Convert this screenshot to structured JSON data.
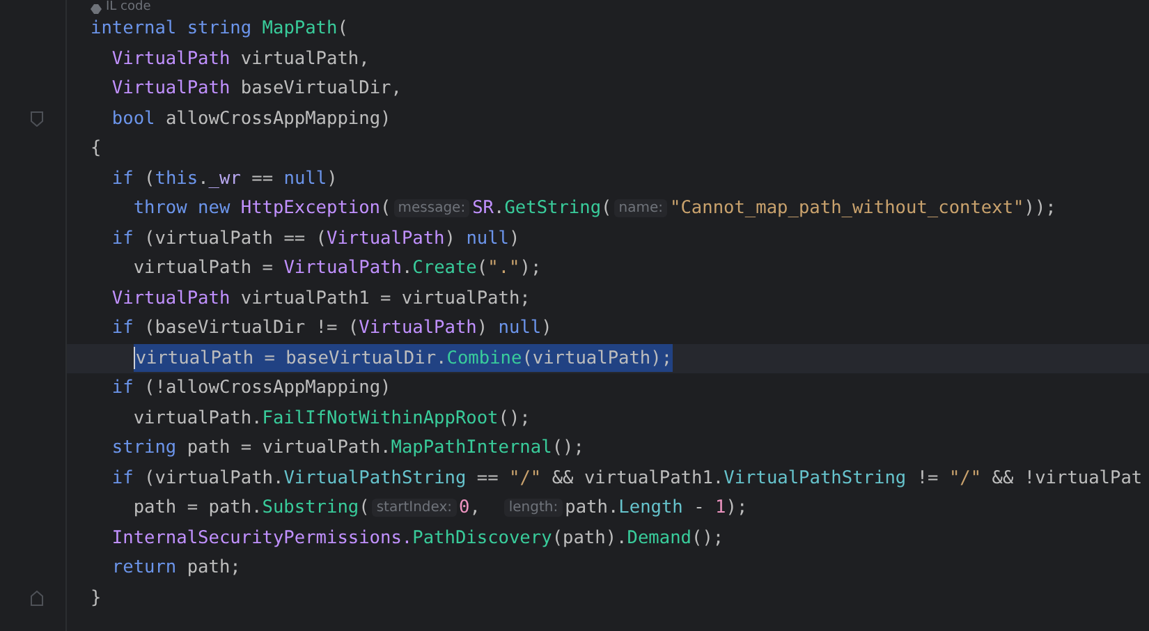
{
  "code_lens": {
    "label": "IL code"
  },
  "lines": [
    {
      "kind": "plain",
      "selected": false,
      "tokens": [
        {
          "kind": "kw",
          "text": "internal string "
        },
        {
          "kind": "method",
          "text": "MapPath"
        },
        {
          "kind": "plain",
          "text": "("
        }
      ],
      "children": [
        {
          "kind": "plain",
          "selected": false,
          "tokens": [
            {
              "kind": "type",
              "text": "VirtualPath"
            },
            {
              "kind": "plain",
              "text": " virtualPath,"
            }
          ]
        },
        {
          "kind": "plain",
          "selected": false,
          "tokens": [
            {
              "kind": "type",
              "text": "VirtualPath"
            },
            {
              "kind": "plain",
              "text": " baseVirtualDir,"
            }
          ]
        },
        {
          "kind": "fold-start",
          "selected": false,
          "tokens": [
            {
              "kind": "kw",
              "text": "bool"
            },
            {
              "kind": "plain",
              "text": " allowCrossAppMapping)"
            }
          ]
        }
      ]
    },
    {
      "kind": "plain",
      "selected": false,
      "tokens": [
        {
          "kind": "plain",
          "text": "{"
        }
      ],
      "children": [
        {
          "kind": "plain",
          "selected": false,
          "tokens": [
            {
              "kind": "kw",
              "text": "if"
            },
            {
              "kind": "plain",
              "text": " ("
            },
            {
              "kind": "kw",
              "text": "this"
            },
            {
              "kind": "plain",
              "text": "."
            },
            {
              "kind": "field",
              "text": "_wr"
            },
            {
              "kind": "plain",
              "text": " == "
            },
            {
              "kind": "kw",
              "text": "null"
            },
            {
              "kind": "plain",
              "text": ")"
            }
          ],
          "children": [
            {
              "kind": "plain",
              "selected": false,
              "tokens": [
                {
                  "kind": "kw",
                  "text": "throw new "
                },
                {
                  "kind": "type",
                  "text": "HttpException"
                },
                {
                  "kind": "plain",
                  "text": "("
                },
                {
                  "kind": "hint",
                  "text": "message:"
                },
                {
                  "kind": "type",
                  "text": "SR"
                },
                {
                  "kind": "plain",
                  "text": "."
                },
                {
                  "kind": "method",
                  "text": "GetString"
                },
                {
                  "kind": "plain",
                  "text": "("
                },
                {
                  "kind": "hint",
                  "text": "name:"
                },
                {
                  "kind": "str",
                  "text": "\"Cannot_map_path_without_context\""
                },
                {
                  "kind": "plain",
                  "text": "));"
                }
              ]
            }
          ]
        },
        {
          "kind": "plain",
          "selected": false,
          "tokens": [
            {
              "kind": "kw",
              "text": "if"
            },
            {
              "kind": "plain",
              "text": " (virtualPath == ("
            },
            {
              "kind": "type",
              "text": "VirtualPath"
            },
            {
              "kind": "plain",
              "text": ") "
            },
            {
              "kind": "kw",
              "text": "null"
            },
            {
              "kind": "plain",
              "text": ")"
            }
          ],
          "children": [
            {
              "kind": "plain",
              "selected": false,
              "tokens": [
                {
                  "kind": "plain",
                  "text": "virtualPath = "
                },
                {
                  "kind": "type",
                  "text": "VirtualPath"
                },
                {
                  "kind": "plain",
                  "text": "."
                },
                {
                  "kind": "method",
                  "text": "Create"
                },
                {
                  "kind": "plain",
                  "text": "("
                },
                {
                  "kind": "str",
                  "text": "\".\""
                },
                {
                  "kind": "plain",
                  "text": ");"
                }
              ]
            }
          ]
        },
        {
          "kind": "plain",
          "selected": false,
          "tokens": [
            {
              "kind": "type",
              "text": "VirtualPath"
            },
            {
              "kind": "plain",
              "text": " virtualPath1 = virtualPath;"
            }
          ]
        },
        {
          "kind": "plain",
          "selected": false,
          "tokens": [
            {
              "kind": "kw",
              "text": "if"
            },
            {
              "kind": "plain",
              "text": " (baseVirtualDir != ("
            },
            {
              "kind": "type",
              "text": "VirtualPath"
            },
            {
              "kind": "plain",
              "text": ") "
            },
            {
              "kind": "kw",
              "text": "null"
            },
            {
              "kind": "plain",
              "text": ")"
            }
          ],
          "children": [
            {
              "kind": "plain",
              "selected": true,
              "tokens": [
                {
                  "kind": "plain",
                  "text": "virtualPath = baseVirtualDir."
                },
                {
                  "kind": "method",
                  "text": "Combine"
                },
                {
                  "kind": "plain",
                  "text": "(virtualPath);"
                }
              ]
            }
          ]
        },
        {
          "kind": "plain",
          "selected": false,
          "tokens": [
            {
              "kind": "kw",
              "text": "if"
            },
            {
              "kind": "plain",
              "text": " (!allowCrossAppMapping)"
            }
          ],
          "children": [
            {
              "kind": "plain",
              "selected": false,
              "tokens": [
                {
                  "kind": "plain",
                  "text": "virtualPath."
                },
                {
                  "kind": "method",
                  "text": "FailIfNotWithinAppRoot"
                },
                {
                  "kind": "plain",
                  "text": "();"
                }
              ]
            }
          ]
        },
        {
          "kind": "plain",
          "selected": false,
          "tokens": [
            {
              "kind": "kw",
              "text": "string"
            },
            {
              "kind": "plain",
              "text": " path = virtualPath."
            },
            {
              "kind": "method",
              "text": "MapPathInternal"
            },
            {
              "kind": "plain",
              "text": "();"
            }
          ]
        },
        {
          "kind": "plain",
          "selected": false,
          "tokens": [
            {
              "kind": "kw",
              "text": "if"
            },
            {
              "kind": "plain",
              "text": " (virtualPath."
            },
            {
              "kind": "prop",
              "text": "VirtualPathString"
            },
            {
              "kind": "plain",
              "text": " == "
            },
            {
              "kind": "str",
              "text": "\"/\""
            },
            {
              "kind": "plain",
              "text": " && virtualPath1."
            },
            {
              "kind": "prop",
              "text": "VirtualPathString"
            },
            {
              "kind": "plain",
              "text": " != "
            },
            {
              "kind": "str",
              "text": "\"/\""
            },
            {
              "kind": "plain",
              "text": " && !virtualPat"
            }
          ],
          "children": [
            {
              "kind": "plain",
              "selected": false,
              "tokens": [
                {
                  "kind": "plain",
                  "text": "path = path."
                },
                {
                  "kind": "method",
                  "text": "Substring"
                },
                {
                  "kind": "plain",
                  "text": "("
                },
                {
                  "kind": "hint",
                  "text": "startIndex:"
                },
                {
                  "kind": "num",
                  "text": "0"
                },
                {
                  "kind": "plain",
                  "text": ",  "
                },
                {
                  "kind": "hint",
                  "text": "length:"
                },
                {
                  "kind": "plain",
                  "text": "path."
                },
                {
                  "kind": "prop",
                  "text": "Length"
                },
                {
                  "kind": "plain",
                  "text": " - "
                },
                {
                  "kind": "num",
                  "text": "1"
                },
                {
                  "kind": "plain",
                  "text": ");"
                }
              ]
            }
          ]
        },
        {
          "kind": "plain",
          "selected": false,
          "tokens": [
            {
              "kind": "type",
              "text": "InternalSecurityPermissions."
            },
            {
              "kind": "method",
              "text": "PathDiscovery"
            },
            {
              "kind": "plain",
              "text": "(path)."
            },
            {
              "kind": "method",
              "text": "Demand"
            },
            {
              "kind": "plain",
              "text": "();"
            }
          ]
        },
        {
          "kind": "plain",
          "selected": false,
          "tokens": [
            {
              "kind": "kw",
              "text": "return"
            },
            {
              "kind": "plain",
              "text": " path;"
            }
          ]
        }
      ]
    },
    {
      "kind": "fold-end",
      "selected": false,
      "tokens": [
        {
          "kind": "plain",
          "text": "}"
        }
      ]
    }
  ]
}
